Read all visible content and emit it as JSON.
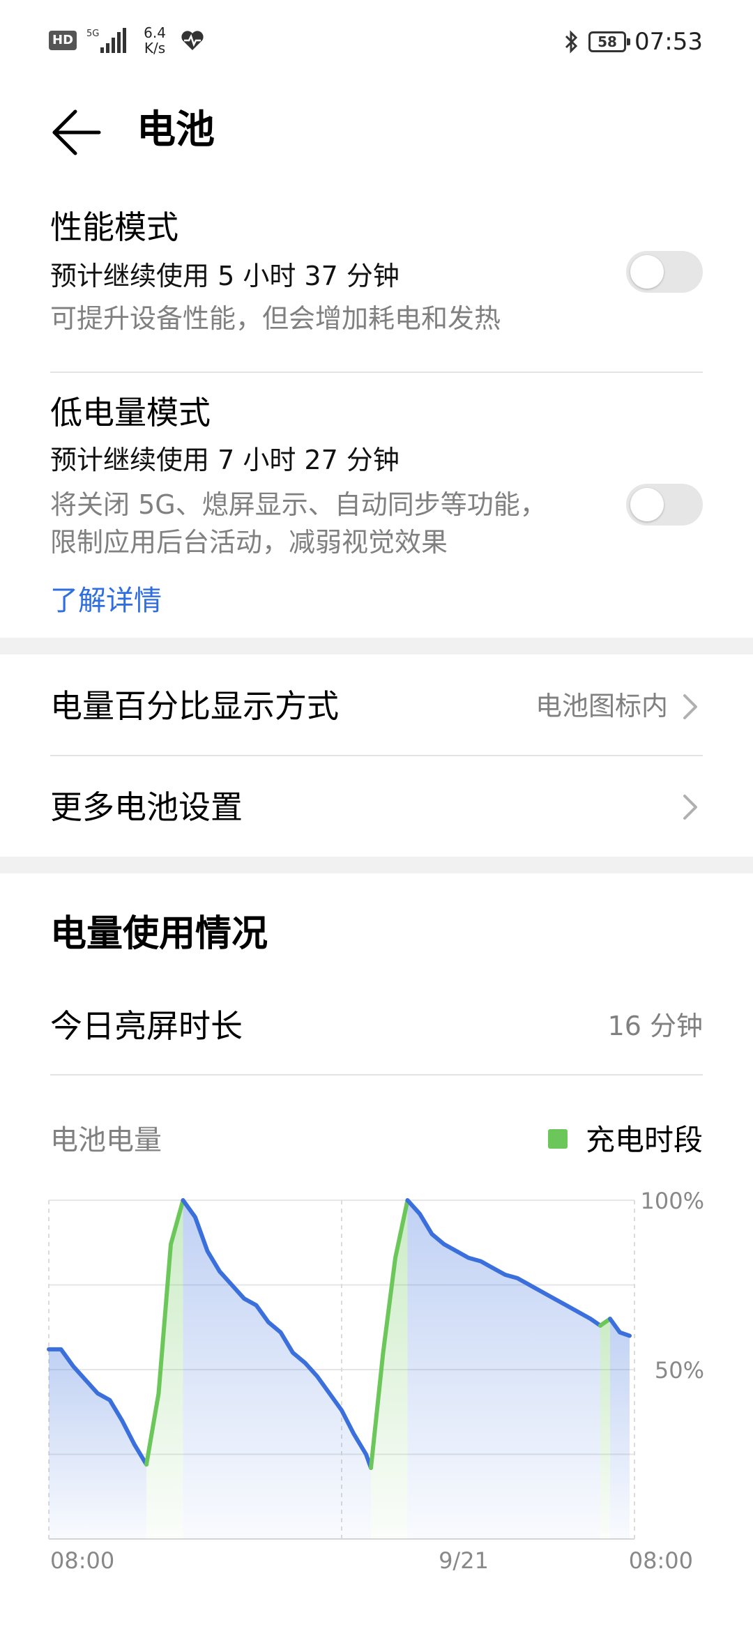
{
  "status_bar": {
    "hd": "HD",
    "network": "5G",
    "speed_value": "6.4",
    "speed_unit": "K/s",
    "battery_level": "58",
    "time": "07:53"
  },
  "header": {
    "title": "电池"
  },
  "performance_mode": {
    "title": "性能模式",
    "estimate": "预计继续使用 5 小时 37 分钟",
    "description": "可提升设备性能，但会增加耗电和发热",
    "enabled": false
  },
  "low_power_mode": {
    "title": "低电量模式",
    "estimate": "预计继续使用 7 小时 27 分钟",
    "description_line1": "将关闭 5G、熄屏显示、自动同步等功能，",
    "description_line2": "限制应用后台活动，减弱视觉效果",
    "learn_more": "了解详情",
    "enabled": false
  },
  "settings": {
    "percentage_display_label": "电量百分比显示方式",
    "percentage_display_value": "电池图标内",
    "more_settings_label": "更多电池设置"
  },
  "usage": {
    "section_title": "电量使用情况",
    "screen_time_label": "今日亮屏时长",
    "screen_time_value": "16 分钟"
  },
  "colors": {
    "accent_blue": "#3a6fdc",
    "charging_green": "#6cc75a",
    "link_blue": "#2f6ee0"
  },
  "chart_data": {
    "type": "area",
    "title": "电池电量",
    "legend": [
      {
        "name": "充电时段",
        "color": "#6cc75a"
      }
    ],
    "legend_placement": "top-right",
    "x_tick_labels": [
      "08:00",
      "9/21",
      "08:00"
    ],
    "y_tick_labels": [
      "100%",
      "50%"
    ],
    "ylim": [
      0,
      100
    ],
    "xlim_hours": [
      0,
      24
    ],
    "grid": true,
    "series": [
      {
        "x": [
          0,
          0.5,
          1.0,
          1.5,
          2.0,
          2.5,
          3.0,
          3.5,
          4.0
        ],
        "y": [
          56,
          56,
          51,
          47,
          43,
          41,
          35,
          28,
          22
        ],
        "charging": false
      },
      {
        "x": [
          4.0,
          4.5,
          5.0,
          5.5
        ],
        "y": [
          22,
          43,
          87,
          100
        ],
        "charging": true
      },
      {
        "x": [
          5.5,
          6.0,
          6.5,
          7.0,
          7.5,
          8.0,
          8.5,
          9.0,
          9.5,
          10.0,
          10.5,
          11.0,
          11.5,
          12.0,
          12.5,
          13.0,
          13.2
        ],
        "y": [
          100,
          95,
          85,
          79,
          75,
          71,
          69,
          64,
          61,
          55,
          52,
          48,
          43,
          38,
          31,
          25,
          21
        ],
        "charging": false
      },
      {
        "x": [
          13.2,
          13.7,
          14.2,
          14.7
        ],
        "y": [
          21,
          55,
          83,
          100
        ],
        "charging": true
      },
      {
        "x": [
          14.7,
          15.2,
          15.7,
          16.2,
          16.7,
          17.2,
          17.7,
          18.2,
          18.7,
          19.2,
          19.7,
          20.2,
          20.7,
          21.2,
          21.7,
          22.2,
          22.6
        ],
        "y": [
          100,
          96,
          90,
          87,
          85,
          83,
          82,
          80,
          78,
          77,
          75,
          73,
          71,
          69,
          67,
          65,
          63
        ],
        "charging": false
      },
      {
        "x": [
          22.6,
          23.0
        ],
        "y": [
          63,
          65
        ],
        "charging": true
      },
      {
        "x": [
          23.0,
          23.4,
          23.8
        ],
        "y": [
          65,
          61,
          60
        ],
        "charging": false
      }
    ]
  }
}
